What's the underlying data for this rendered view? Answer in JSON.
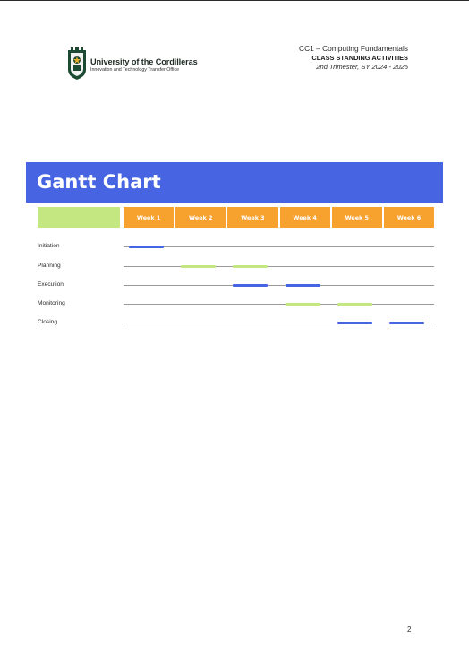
{
  "header": {
    "university_name": "University of the Cordilleras",
    "office_name": "Innovation and Technology Transfer Office",
    "course": "CC1 – Computing Fundamentals",
    "activity": "CLASS STANDING ACTIVITIES",
    "term": "2nd Trimester, SY 2024 - 2025"
  },
  "banner": {
    "title": "Gantt Chart"
  },
  "gantt": {
    "weeks": [
      "Week 1",
      "Week 2",
      "Week 3",
      "Week 4",
      "Week 5",
      "Week 6"
    ],
    "tasks": [
      {
        "name": "Initiation",
        "bars": [
          {
            "week": 1,
            "color": "blue"
          }
        ]
      },
      {
        "name": "Planning",
        "bars": [
          {
            "week": 2,
            "color": "green"
          },
          {
            "week": 3,
            "color": "green"
          }
        ]
      },
      {
        "name": "Execution",
        "bars": [
          {
            "week": 3,
            "color": "blue"
          },
          {
            "week": 4,
            "color": "blue"
          }
        ]
      },
      {
        "name": "Monitoring",
        "bars": [
          {
            "week": 4,
            "color": "green"
          },
          {
            "week": 5,
            "color": "green"
          }
        ]
      },
      {
        "name": "Closing",
        "bars": [
          {
            "week": 5,
            "color": "blue"
          },
          {
            "week": 6,
            "color": "blue"
          }
        ]
      }
    ],
    "colors": {
      "blue": "#4765e3",
      "green": "#c4e782",
      "week_header": "#f7a12e"
    }
  },
  "footer": {
    "page_number": "2"
  }
}
